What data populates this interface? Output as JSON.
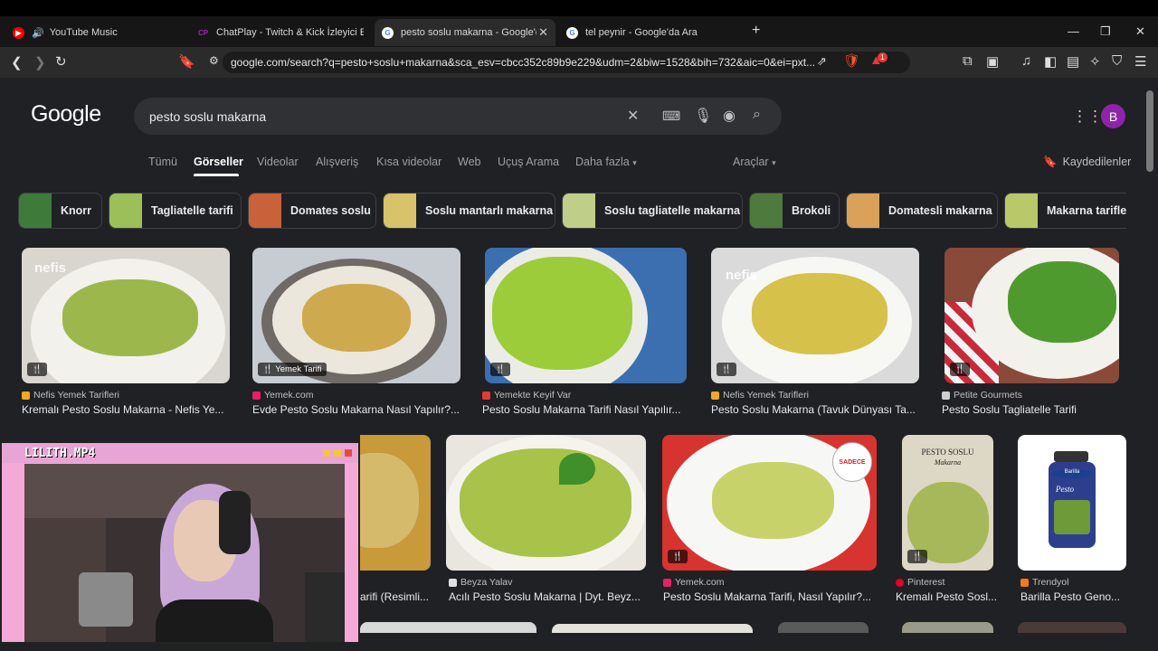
{
  "browser": {
    "tabs": [
      {
        "label": "YouTube Music",
        "active": false
      },
      {
        "label": "ChatPlay - Twitch & Kick İzleyici Etkile",
        "active": false
      },
      {
        "label": "pesto soslu makarna - Google'da",
        "active": true
      },
      {
        "label": "tel peynir - Google'da Ara",
        "active": false
      }
    ],
    "url": "google.com/search?q=pesto+soslu+makarna&sca_esv=cbcc352c89b9e229&udm=2&biw=1528&bih=732&aic=0&ei=pxt...",
    "extension_badge": "1"
  },
  "google": {
    "logo": "Google",
    "query": "pesto soslu makarna",
    "avatar_letter": "B",
    "nav_tabs": [
      "Tümü",
      "Görseller",
      "Videolar",
      "Alışveriş",
      "Kısa videolar",
      "Web",
      "Uçuş Arama",
      "Daha fazla"
    ],
    "tools_label": "Araçlar",
    "saved_label": "Kaydedilenler",
    "chips": [
      "Knorr",
      "Tagliatelle tarifi",
      "Domates soslu",
      "Soslu mantarlı makarna",
      "Soslu tagliatelle makarna",
      "Brokoli",
      "Domatesli makarna",
      "Makarna tarifler"
    ],
    "row1": [
      {
        "source": "Nefis Yemek Tarifleri",
        "title": "Kremalı Pesto Soslu Makarna - Nefis Ye...",
        "badge": ""
      },
      {
        "source": "Yemek.com",
        "title": "Evde Pesto Soslu Makarna Nasıl Yapılır?...",
        "badge": "Yemek Tarifi"
      },
      {
        "source": "Yemekte Keyif Var",
        "title": "Pesto Soslu Makarna Tarifi Nasıl Yapılır...",
        "badge": ""
      },
      {
        "source": "Nefis Yemek Tarifleri",
        "title": "Pesto Soslu Makarna (Tavuk Dünyası Ta...",
        "badge": ""
      },
      {
        "source": "Petite Gourmets",
        "title": "Pesto Soslu Tagliatelle Tarifi",
        "badge": ""
      }
    ],
    "row2": [
      {
        "source": "",
        "title": "arifi (Resimli..."
      },
      {
        "source": "Beyza Yalav",
        "title": "Acılı Pesto Soslu Makarna | Dyt. Beyz..."
      },
      {
        "source": "Yemek.com",
        "title": "Pesto Soslu Makarna Tarifi, Nasıl Yapılır?..."
      },
      {
        "source": "Pinterest",
        "title": "Kremalı Pesto Sosl..."
      },
      {
        "source": "Trendyol",
        "title": "Barilla Pesto Geno..."
      }
    ],
    "image_texts": {
      "nefis1": "nefis",
      "nefis2": "nefis",
      "book_title": "PESTO SOSLU",
      "book_sub": "Makarna",
      "sadece": "SADECE",
      "barilla": "Barilla",
      "pesto_jar": "Pesto"
    }
  },
  "stream_overlay": {
    "title": "LILITH.MP4"
  },
  "colors": {
    "accent_avatar": "#8e24aa",
    "overlay_pink": "#f4a9d8",
    "page_bg": "#202124"
  }
}
